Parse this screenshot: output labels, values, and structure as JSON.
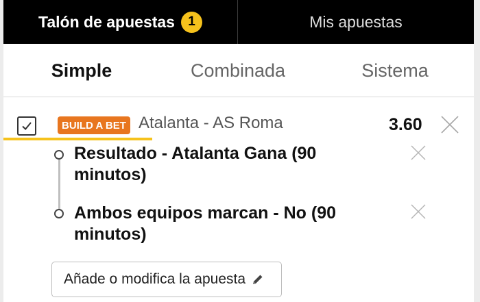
{
  "top_tabs": {
    "betslip_label": "Talón de apuestas",
    "betslip_count": "1",
    "my_bets_label": "Mis apuestas"
  },
  "mode_tabs": [
    {
      "label": "Simple",
      "active": true
    },
    {
      "label": "Combinada",
      "active": false
    },
    {
      "label": "Sistema",
      "active": false
    }
  ],
  "bet": {
    "checked": true,
    "badge": "BUILD A BET",
    "match": "Atalanta - AS Roma",
    "odds": "3.60",
    "selections": [
      {
        "line1": "Resultado - Atalanta Gana (90",
        "line2": "minutos)"
      },
      {
        "line1": "Ambos equipos marcan - No (90",
        "line2": "minutos)"
      }
    ],
    "edit_button": "Añade o modifica la apuesta"
  },
  "colors": {
    "accent": "#f6c21c",
    "badge": "#e8761f",
    "topbar": "#000000"
  },
  "icons": [
    "checkmark-icon",
    "close-icon",
    "pencil-icon"
  ]
}
